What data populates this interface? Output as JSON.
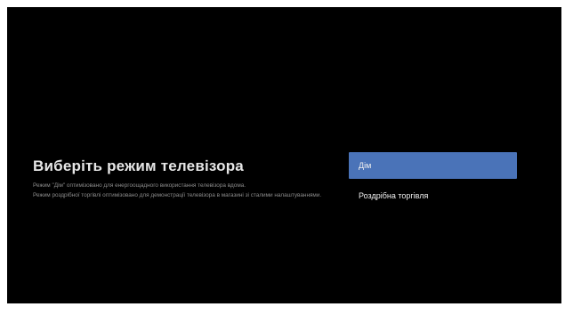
{
  "setup": {
    "title": "Виберіть режим телевізора",
    "description": [
      "Режим \"Дім\" оптимізовано для енергоощадного використання телевізора вдома.",
      "Режим роздрібної торгівлі оптимізовано для демонстрації телевізора в магазині зі сталими налаштуваннями."
    ]
  },
  "options": [
    {
      "label": "Дім",
      "selected": true
    },
    {
      "label": "Роздрібна торгівля",
      "selected": false
    }
  ],
  "colors": {
    "background": "#000000",
    "accent": "#4a73b8",
    "title_text": "#e6e6e6",
    "description_text": "#8c8c8c"
  }
}
